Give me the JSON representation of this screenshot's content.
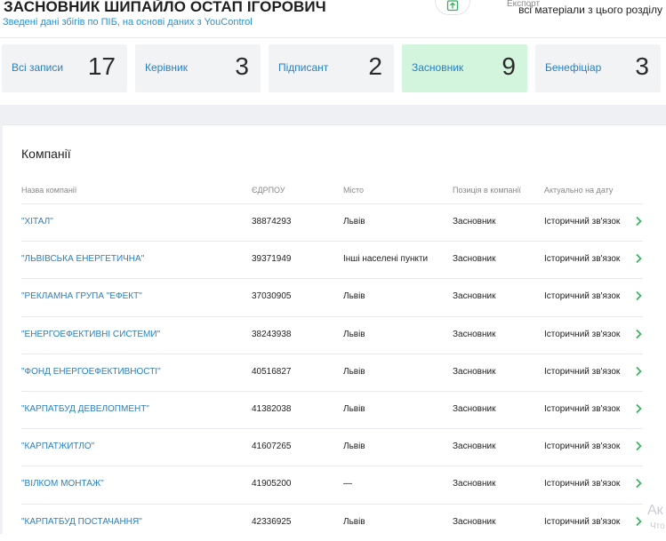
{
  "header": {
    "title": "ЗАСНОВНИК ШИПАЙЛО ОСТАП ІГОРОВИЧ",
    "subtitle": "Зведені дані збігів по ПІБ, на основі даних з YouControl",
    "export_caption": "Експорт",
    "export_text": "всі матеріали з цього розділу"
  },
  "cards": [
    {
      "label": "Всі записи",
      "count": "17",
      "active": false
    },
    {
      "label": "Керівник",
      "count": "3",
      "active": false
    },
    {
      "label": "Підписант",
      "count": "2",
      "active": false
    },
    {
      "label": "Засновник",
      "count": "9",
      "active": true
    },
    {
      "label": "Бенефіціар",
      "count": "3",
      "active": false
    }
  ],
  "panel": {
    "title": "Компанії",
    "columns": [
      "Назва компанії",
      "ЄДРПОУ",
      "Місто",
      "Позиція в компанії",
      "Актуально на дату"
    ]
  },
  "rows": [
    {
      "name": "\"ХІТАЛ\"",
      "code": "38874293",
      "city": "Львів",
      "position": "Засновник",
      "date": "Історичний зв'язок"
    },
    {
      "name": "\"ЛЬВІВСЬКА ЕНЕРГЕТИЧНА\"",
      "code": "39371949",
      "city": "Інші населені пункти",
      "position": "Засновник",
      "date": "Історичний зв'язок"
    },
    {
      "name": "\"РЕКЛАМНА ГРУПА \"ЕФЕКТ\"",
      "code": "37030905",
      "city": "Львів",
      "position": "Засновник",
      "date": "Історичний зв'язок"
    },
    {
      "name": "\"ЕНЕРГОЕФЕКТИВНІ СИСТЕМИ\"",
      "code": "38243938",
      "city": "Львів",
      "position": "Засновник",
      "date": "Історичний зв'язок"
    },
    {
      "name": "\"ФОНД ЕНЕРГОЕФЕКТИВНОСТІ\"",
      "code": "40516827",
      "city": "Львів",
      "position": "Засновник",
      "date": "Історичний зв'язок"
    },
    {
      "name": "\"КАРПАТБУД ДЕВЕЛОПМЕНТ\"",
      "code": "41382038",
      "city": "Львів",
      "position": "Засновник",
      "date": "Історичний зв'язок"
    },
    {
      "name": "\"КАРПАТЖИТЛО\"",
      "code": "41607265",
      "city": "Львів",
      "position": "Засновник",
      "date": "Історичний зв'язок"
    },
    {
      "name": "\"ВІЛКОМ МОНТАЖ\"",
      "code": "41905200",
      "city": "—",
      "position": "Засновник",
      "date": "Історичний зв'язок"
    },
    {
      "name": "\"КАРПАТБУД ПОСТАЧАННЯ\"",
      "code": "42336925",
      "city": "Львів",
      "position": "Засновник",
      "date": "Історичний зв'язок"
    }
  ],
  "watermark": {
    "line1": "Ак",
    "line2": "Что"
  },
  "colors": {
    "accent": "#2a7fc0",
    "active_card": "#d3f5de",
    "chevron": "#2fb15a"
  },
  "icons": {
    "export": "upload-icon",
    "row": "chevron-right-icon"
  }
}
